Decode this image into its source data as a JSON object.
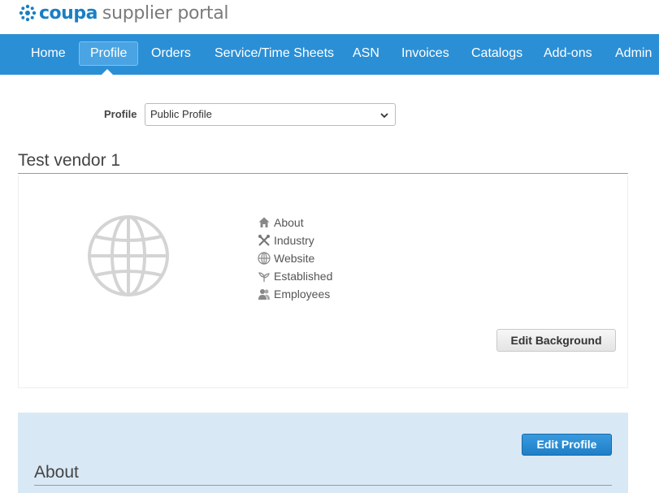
{
  "header": {
    "brand": "coupa",
    "portal": "supplier portal"
  },
  "nav": {
    "items": [
      {
        "label": "Home",
        "active": false
      },
      {
        "label": "Profile",
        "active": true
      },
      {
        "label": "Orders",
        "active": false
      },
      {
        "label": "Service/Time Sheets",
        "active": false
      },
      {
        "label": "ASN",
        "active": false
      },
      {
        "label": "Invoices",
        "active": false
      },
      {
        "label": "Catalogs",
        "active": false
      },
      {
        "label": "Add-ons",
        "active": false
      },
      {
        "label": "Admin",
        "active": false
      }
    ]
  },
  "profile_select": {
    "label": "Profile",
    "value": "Public Profile"
  },
  "vendor": {
    "name": "Test vendor 1"
  },
  "facts": [
    {
      "icon": "home-icon",
      "label": "About"
    },
    {
      "icon": "wrench-icon",
      "label": "Industry"
    },
    {
      "icon": "globe-icon",
      "label": "Website"
    },
    {
      "icon": "sprout-icon",
      "label": "Established"
    },
    {
      "icon": "people-icon",
      "label": "Employees"
    }
  ],
  "buttons": {
    "edit_background": "Edit Background",
    "edit_profile": "Edit Profile"
  },
  "about": {
    "title": "About"
  },
  "colors": {
    "nav_bg": "#2b8fd6",
    "brand_blue": "#1a7fc4",
    "about_bg": "#d9e8f5"
  }
}
